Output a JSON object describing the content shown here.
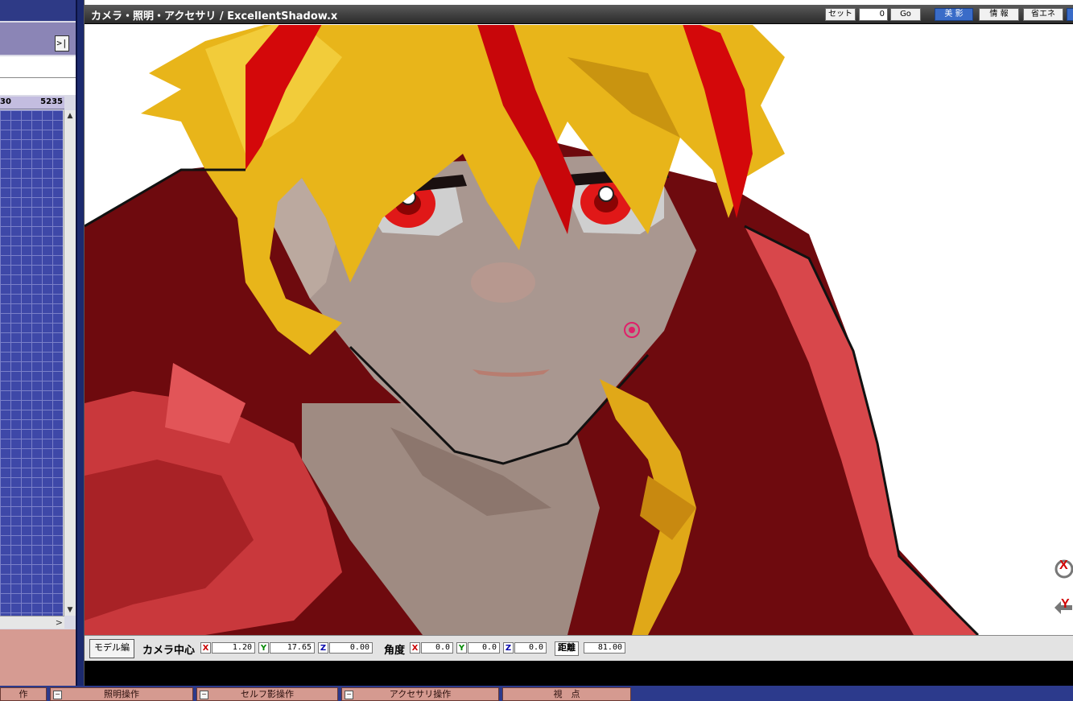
{
  "left_panel": {
    "collapse_symbol": ">|",
    "frame_start": "30",
    "frame_end": "5235",
    "scroll_up": "▲",
    "scroll_down": "▼",
    "scroll_right": ">"
  },
  "window": {
    "title": "カメラ・照明・アクセサリ / ExcellentShadow.x",
    "set_button": "セット",
    "frame_value": "0",
    "go_button": "Go",
    "beauty_button": "美 影",
    "info_button": "情 報",
    "save_energy_button": "省エネ"
  },
  "camera_bar": {
    "mode_button": "モデル編",
    "center_label": "カメラ中心",
    "center": {
      "x_label": "X",
      "x": "1.20",
      "y_label": "Y",
      "y": "17.65",
      "z_label": "Z",
      "z": "0.00"
    },
    "angle_label": "角度",
    "angle": {
      "x_label": "X",
      "x": "0.0",
      "y_label": "Y",
      "y": "0.0",
      "z_label": "Z",
      "z": "0.0"
    },
    "distance_label": "距離",
    "distance": "81.00"
  },
  "bottom_tabs": [
    {
      "label": "作",
      "mini": "−"
    },
    {
      "label": "照明操作",
      "mini": "−"
    },
    {
      "label": "セルフ影操作",
      "mini": "−"
    },
    {
      "label": "アクセサリ操作",
      "mini": "−"
    },
    {
      "label": "視　点",
      "mini": ""
    }
  ],
  "gizmos": [
    {
      "name": "x-axis-rotate-gizmo",
      "letter": "X"
    },
    {
      "name": "y-axis-move-gizmo",
      "letter": "Y"
    }
  ],
  "colors": {
    "hair": "#e8b51a",
    "hair_highlight": "#d4080a",
    "hood": "#7a0d10",
    "hood_light": "#dd4a4c",
    "skin": "#a8958a",
    "eye": "#e01818"
  }
}
